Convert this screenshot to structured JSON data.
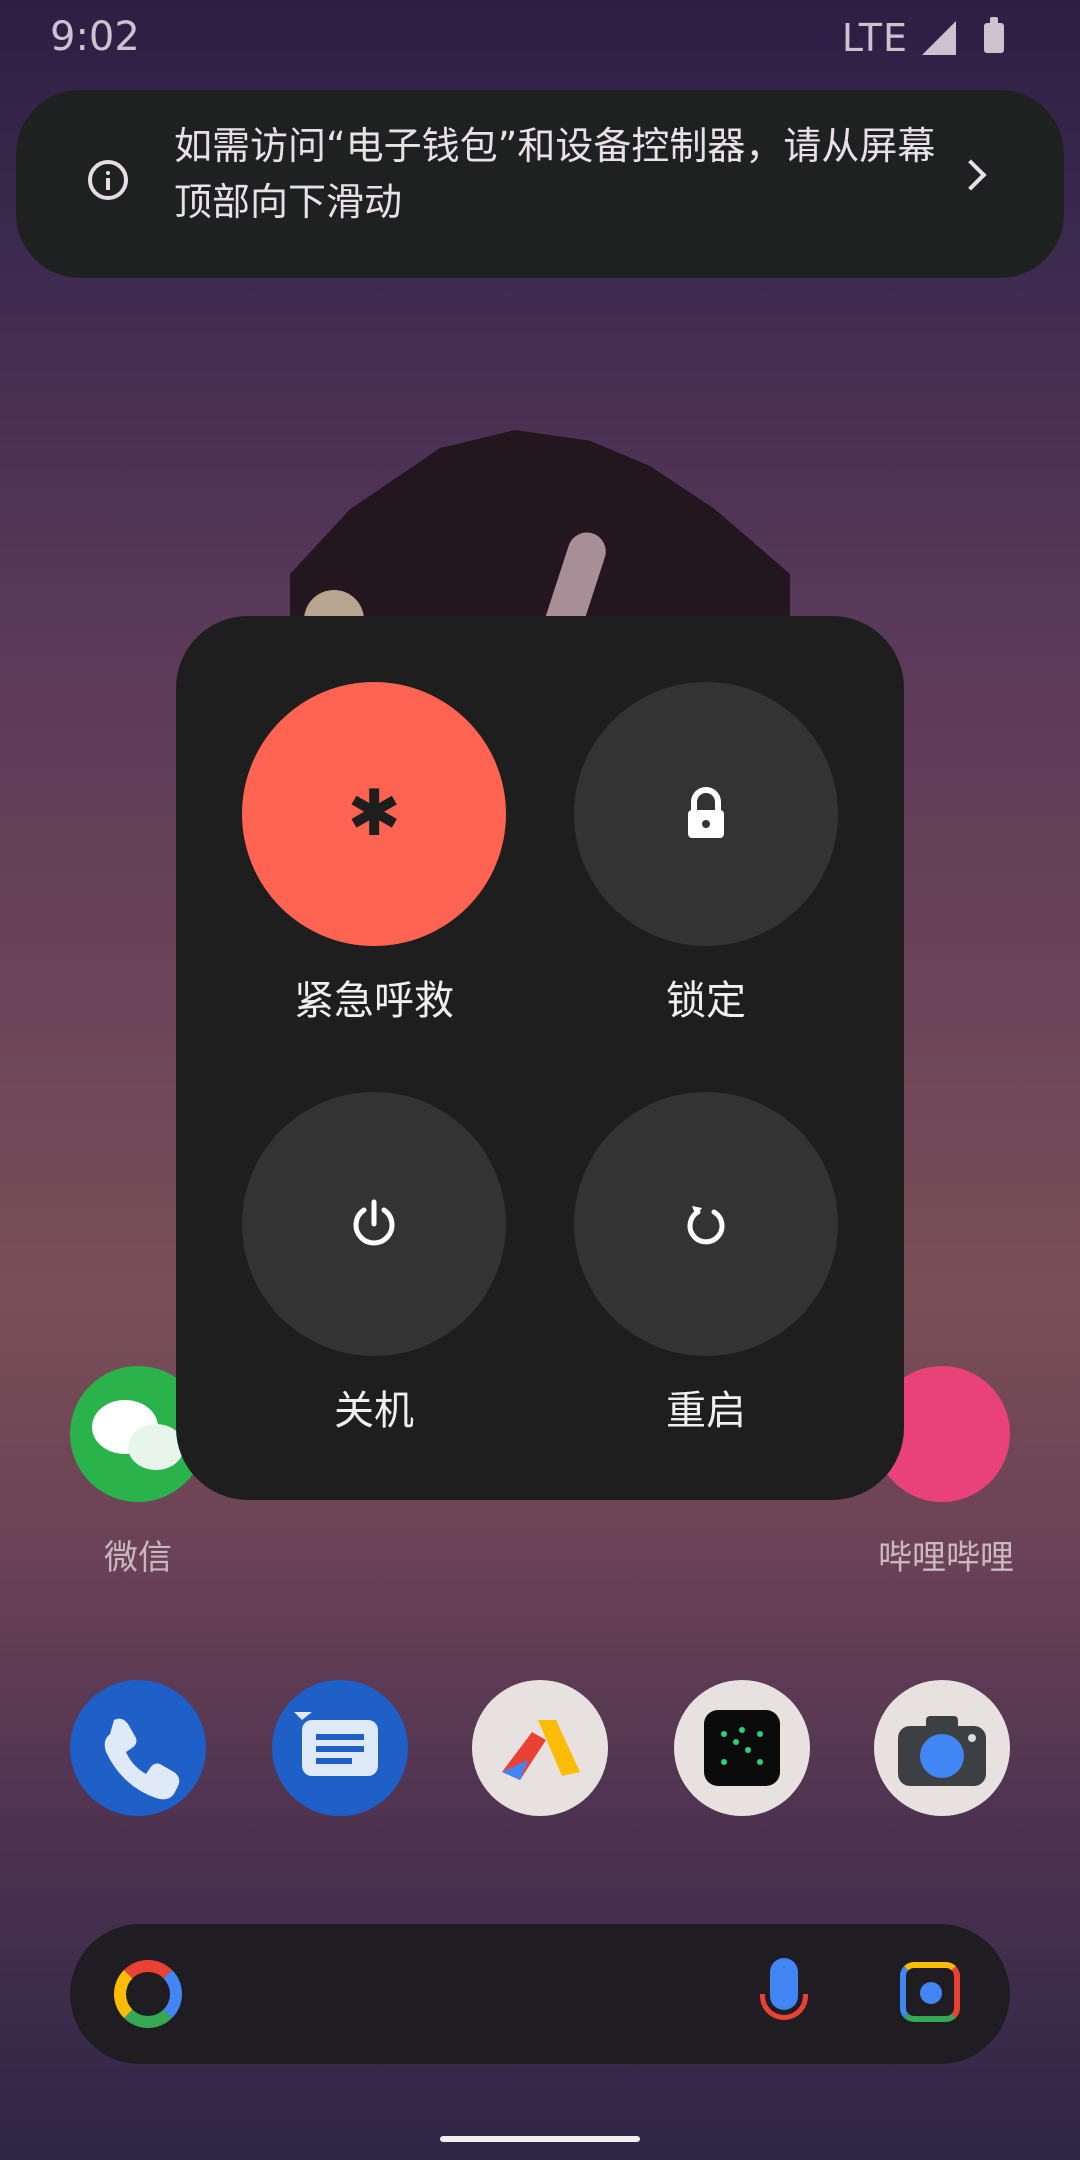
{
  "status_bar": {
    "time": "9:02",
    "network": "LTE"
  },
  "banner": {
    "message": "如需访问“电子钱包”和设备控制器，请从屏幕顶部向下滑动"
  },
  "home": {
    "apps": [
      {
        "label": "微信"
      },
      {
        "label": "哔哩哔哩"
      }
    ]
  },
  "power_menu": {
    "emergency_label": "紧急呼救",
    "lock_label": "锁定",
    "power_off_label": "关机",
    "restart_label": "重启"
  },
  "colors": {
    "dialog_bg": "#1d1e1d",
    "emergency": "#ff6352",
    "button_bg": "#333333"
  }
}
